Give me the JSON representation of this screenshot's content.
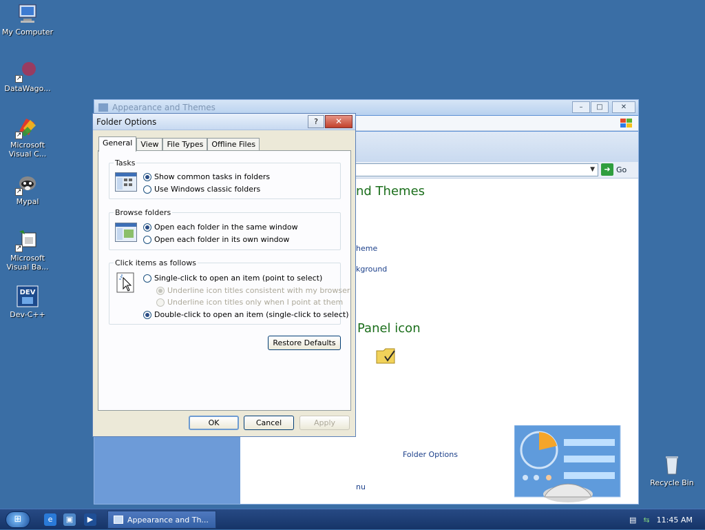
{
  "desktop": {
    "icons": [
      {
        "label": "My Computer",
        "icon": "computer-icon"
      },
      {
        "label": "DataWago...",
        "icon": "app-icon"
      },
      {
        "label": "Microsoft Visual C...",
        "icon": "visual-c-icon"
      },
      {
        "label": "Mypal",
        "icon": "raccoon-icon"
      },
      {
        "label": "Microsoft Visual Ba...",
        "icon": "visual-basic-icon"
      },
      {
        "label": "Dev-C++",
        "icon": "dev-cpp-icon"
      },
      {
        "label": "Recycle Bin",
        "icon": "recycle-bin-icon"
      }
    ]
  },
  "bg_window": {
    "title": "Appearance and Themes",
    "go_label": "Go",
    "heading1": "nd Themes",
    "link1": "heme",
    "link2": "kground",
    "heading2": "Panel icon",
    "folder_options_link": "Folder Options",
    "link3": "nu"
  },
  "dialog": {
    "title": "Folder Options",
    "help_label": "?",
    "close_label": "✕",
    "tabs": [
      "General",
      "View",
      "File Types",
      "Offline Files"
    ],
    "tasks": {
      "label": "Tasks",
      "options": [
        "Show common tasks in folders",
        "Use Windows classic folders"
      ]
    },
    "browse": {
      "label": "Browse folders",
      "options": [
        "Open each folder in the same window",
        "Open each folder in its own window"
      ]
    },
    "click": {
      "label": "Click items as follows",
      "single": "Single-click to open an item (point to select)",
      "underline1": "Underline icon titles consistent with my browser",
      "underline2": "Underline icon titles only when I point at them",
      "double": "Double-click to open an item (single-click to select)"
    },
    "restore_defaults": "Restore Defaults",
    "ok": "OK",
    "cancel": "Cancel",
    "apply": "Apply"
  },
  "taskbar": {
    "task_label": "Appearance and Th...",
    "clock": "11:45 AM"
  },
  "colors": {
    "desktop": "#3a6ea5",
    "heading_green": "#1b6e1b",
    "link_blue": "#1b3f8a"
  }
}
